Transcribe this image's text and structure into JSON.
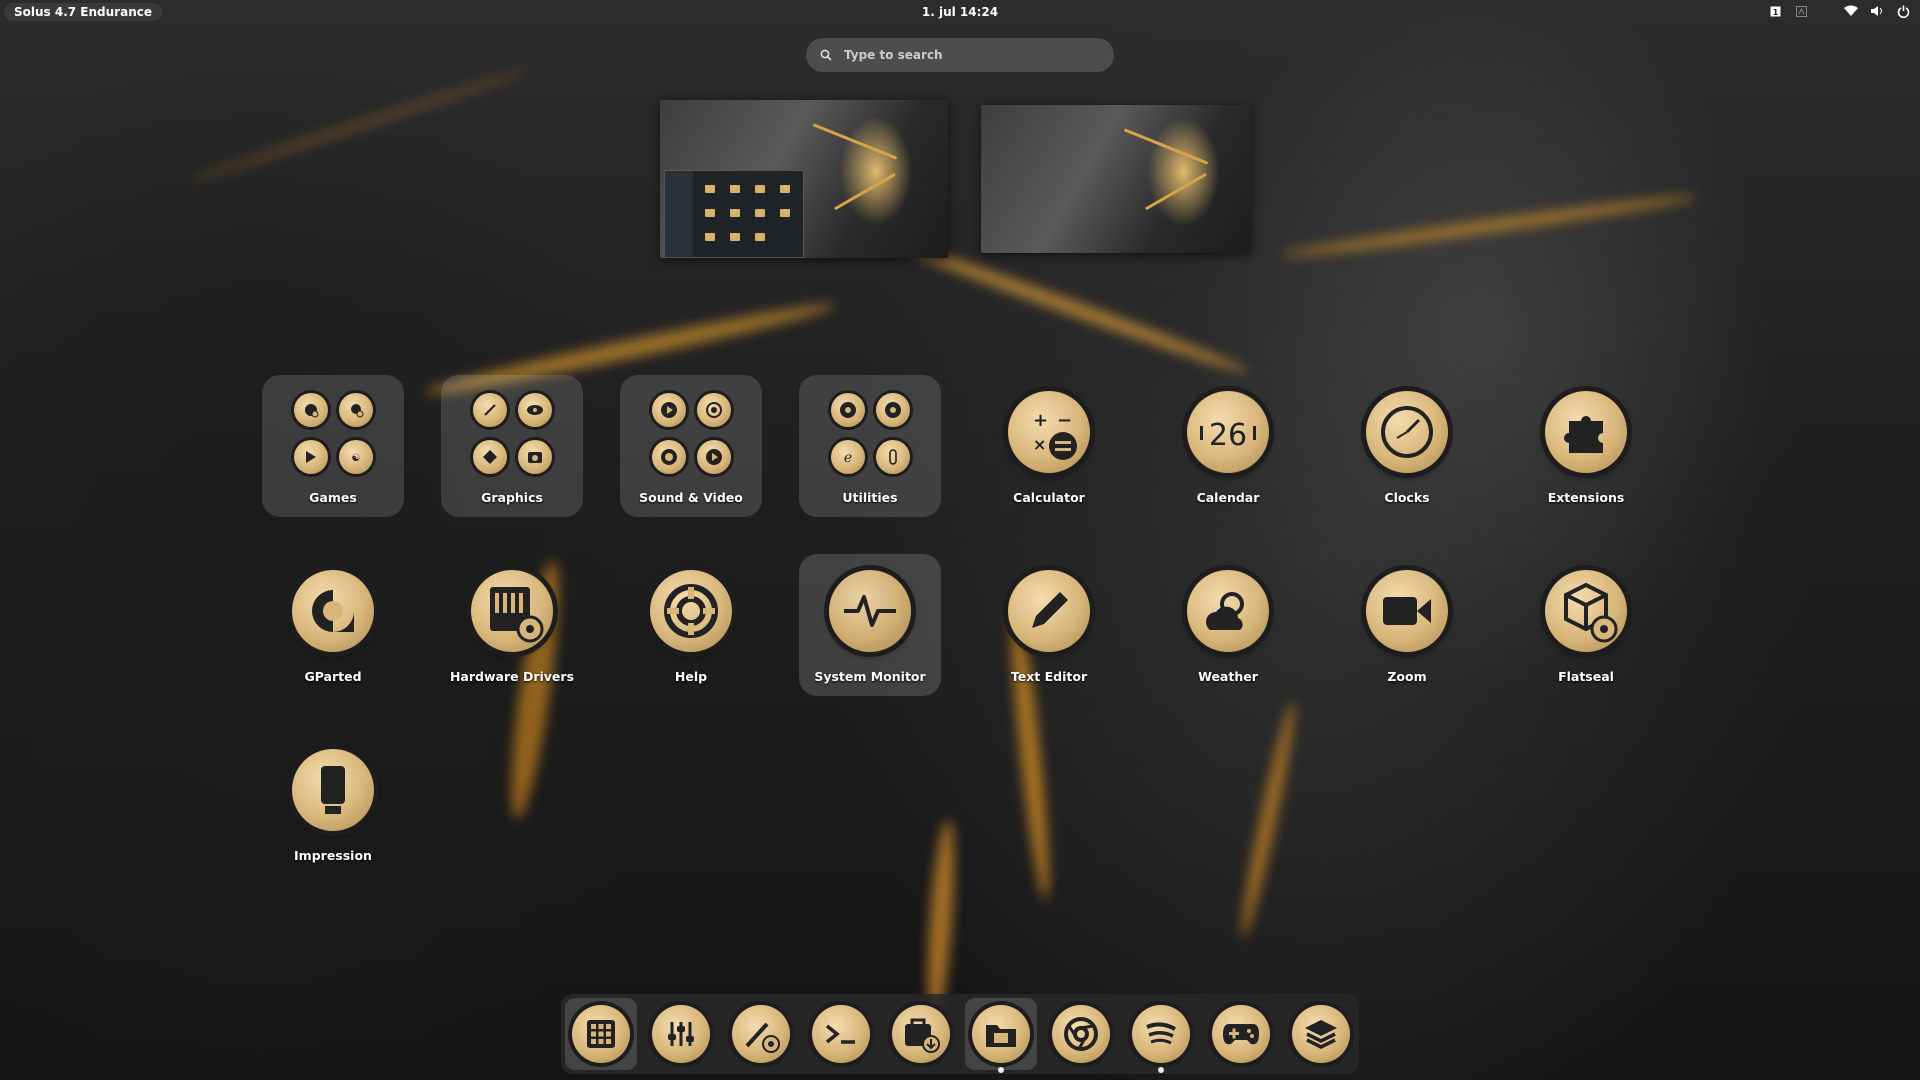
{
  "topbar": {
    "activities_label": "Solus 4.7 Endurance",
    "datetime": "1. jul  14:24",
    "tray_icons": [
      "workspace-indicator-icon",
      "keyboard-layout-icon",
      "wifi-icon",
      "volume-icon",
      "power-icon"
    ],
    "workspace_number": "1"
  },
  "search": {
    "placeholder": "Type to search"
  },
  "workspaces": [
    {
      "name": "workspace-1",
      "has_window": true
    },
    {
      "name": "workspace-2",
      "has_window": false
    }
  ],
  "app_grid": {
    "row1": [
      {
        "label": "Games",
        "type": "folder",
        "icons": [
          "game-icon",
          "game-icon",
          "game-icon",
          "game-icon"
        ]
      },
      {
        "label": "Graphics",
        "type": "folder",
        "icons": [
          "pen-icon",
          "eye-icon",
          "inkscape-icon",
          "screenshot-icon"
        ]
      },
      {
        "label": "Sound & Video",
        "type": "folder",
        "icons": [
          "play-icon",
          "webcam-icon",
          "record-icon",
          "play-icon"
        ]
      },
      {
        "label": "Utilities",
        "type": "folder",
        "icons": [
          "disk-icon",
          "disk-settings-icon",
          "editor-icon",
          "usb-icon"
        ]
      },
      {
        "label": "Calculator",
        "icon": "calculator-icon"
      },
      {
        "label": "Calendar",
        "icon": "calendar-icon",
        "icon_text": "26"
      },
      {
        "label": "Clocks",
        "icon": "clock-icon"
      },
      {
        "label": "Extensions",
        "icon": "puzzle-icon"
      }
    ],
    "row2": [
      {
        "label": "GParted",
        "icon": "gparted-icon"
      },
      {
        "label": "Hardware Drivers",
        "icon": "hardware-drivers-icon"
      },
      {
        "label": "Help",
        "icon": "lifebuoy-icon"
      },
      {
        "label": "System Monitor",
        "icon": "pulse-icon",
        "selected": true
      },
      {
        "label": "Text Editor",
        "icon": "pencil-icon"
      },
      {
        "label": "Weather",
        "icon": "weather-icon"
      },
      {
        "label": "Zoom",
        "icon": "video-camera-icon"
      },
      {
        "label": "Flatseal",
        "icon": "flatseal-icon"
      }
    ],
    "row3": [
      {
        "label": "Impression",
        "icon": "usb-drive-icon"
      }
    ]
  },
  "dock": {
    "items": [
      {
        "name": "show-apps",
        "icon": "grid-icon",
        "active": true,
        "running": false
      },
      {
        "name": "tweaks",
        "icon": "sliders-icon",
        "active": false,
        "running": false
      },
      {
        "name": "extension-manager",
        "icon": "magic-wand-icon",
        "active": false,
        "running": false
      },
      {
        "name": "terminal",
        "icon": "terminal-icon",
        "active": false,
        "running": false
      },
      {
        "name": "software-store",
        "icon": "bag-download-icon",
        "active": false,
        "running": false
      },
      {
        "name": "files",
        "icon": "folder-icon",
        "active": true,
        "running": true
      },
      {
        "name": "chrome",
        "icon": "chrome-icon",
        "active": false,
        "running": false
      },
      {
        "name": "spotify",
        "icon": "spotify-icon",
        "active": false,
        "running": true
      },
      {
        "name": "games",
        "icon": "gamepad-icon",
        "active": false,
        "running": false
      },
      {
        "name": "stack",
        "icon": "layers-icon",
        "active": false,
        "running": false
      }
    ]
  },
  "colors": {
    "accent": "#d8b67a",
    "icon_dark": "#1d1d1d",
    "background": "#1f1f1f"
  }
}
